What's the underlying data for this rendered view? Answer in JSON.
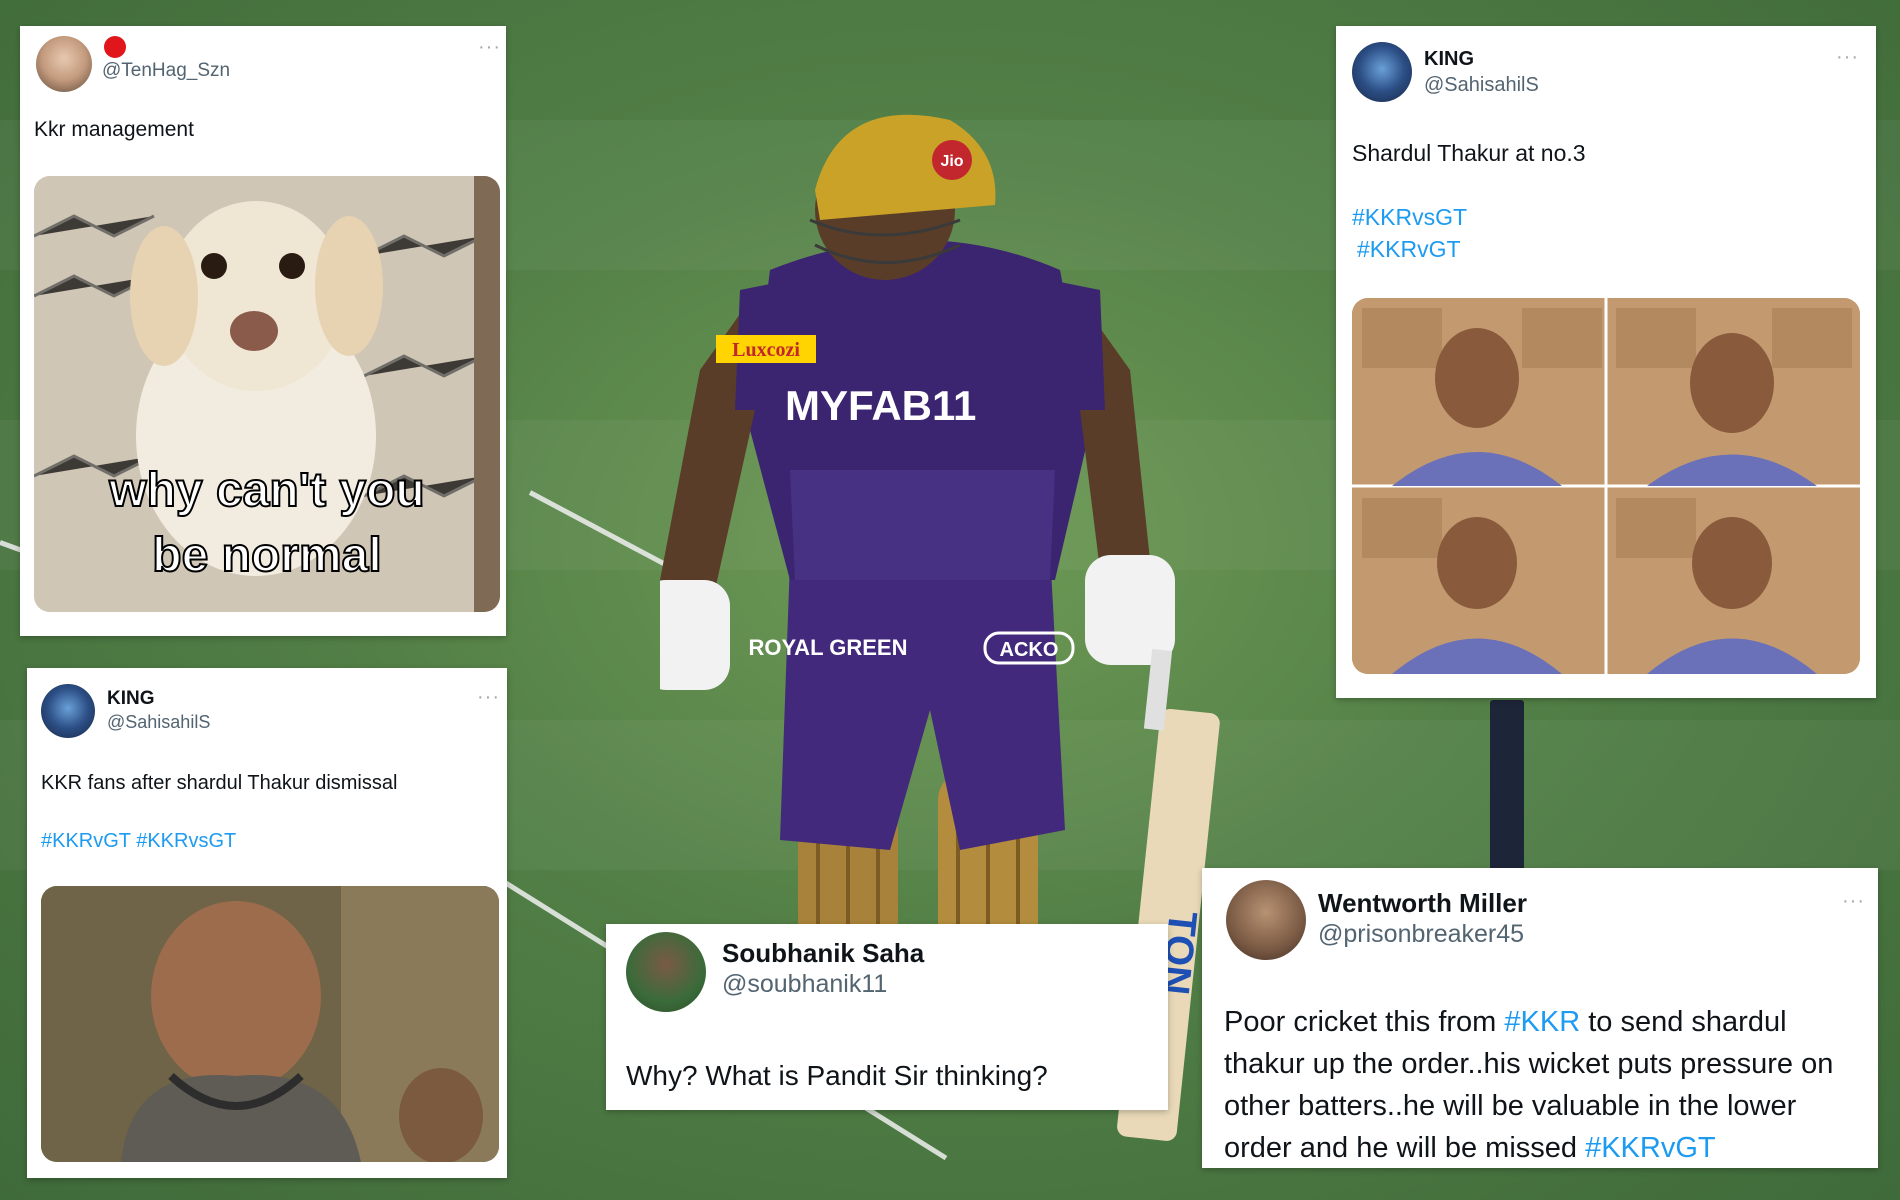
{
  "tweets": [
    {
      "id": "tweet-1",
      "status_icon": "red-dot-icon",
      "handle": "@TenHag_Szn",
      "text": "Kkr management",
      "media_caption_line1": "why can't you",
      "media_caption_line2": "be normal"
    },
    {
      "id": "tweet-2",
      "name": "KING",
      "handle": "@SahisahilS",
      "text": "KKR fans after shardul Thakur dismissal",
      "hashtags": "#KKRvGT #KKRvsGT"
    },
    {
      "id": "tweet-3",
      "name": "KING",
      "handle": "@SahisahilS",
      "text": "Shardul Thakur at no.3",
      "hashtag1": "#KKRvsGT",
      "hashtag2": "#KKRvGT"
    },
    {
      "id": "tweet-4",
      "name": "Soubhanik Saha",
      "handle": "@soubhanik11",
      "text": "Why? What is Pandit Sir thinking?"
    },
    {
      "id": "tweet-5",
      "name": "Wentworth Miller",
      "handle": "@prisonbreaker45",
      "line1_a": "Poor cricket this from ",
      "line1_tag": "#KKR",
      "line1_b": " to send shardul",
      "line2": "thakur up the order..his wicket puts pressure on",
      "line3": "other batters..he will be valuable in the lower",
      "line4_a": "order and he will be missed ",
      "line4_tag": "#KKRvGT"
    }
  ],
  "player": {
    "jersey_sponsor": "MYFAB11",
    "chest_brand": "Luxcozi",
    "helmet_logo": "Jio",
    "shorts_brand": "ACKO",
    "shorts_text": "ROYAL GREEN",
    "bat_brand": "TON"
  },
  "colors": {
    "link": "#1d9bf0",
    "handle": "#536471",
    "kkr_purple": "#3b2470",
    "gold": "#c9a227"
  }
}
